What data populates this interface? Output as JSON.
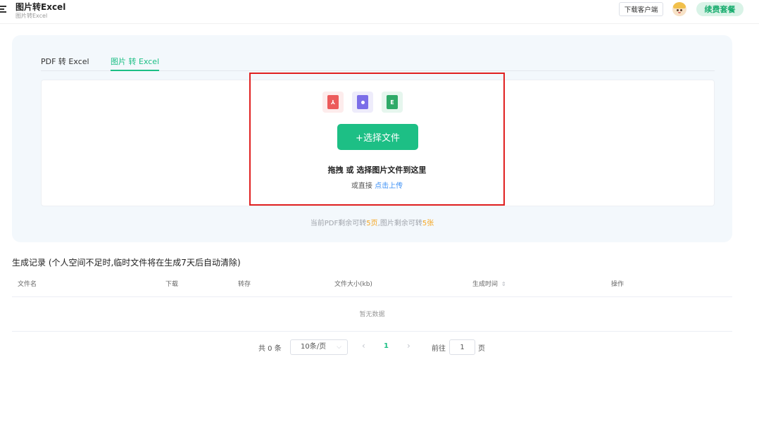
{
  "header": {
    "title": "图片转Excel",
    "subtitle": "图片转Excel",
    "download_client": "下载客户端",
    "renew": "续费套餐"
  },
  "tabs": [
    {
      "label": "PDF 转 Excel"
    },
    {
      "label": "图片 转 Excel"
    }
  ],
  "upload": {
    "file_icons": [
      "pdf-icon",
      "image-file-icon",
      "excel-icon"
    ],
    "pdf_icon_glyph": "⅄",
    "excel_icon_glyph": "E",
    "select_button": "+选择文件",
    "drag_hint": "拖拽 或 选择图片文件到这里",
    "direct_prefix": "或直接",
    "direct_link": "点击上传"
  },
  "quota": {
    "prefix": "当前PDF剩余可转",
    "pdf_num": "5",
    "pdf_unit": "页",
    "mid": ",图片剩余可转",
    "image_num": "5",
    "image_unit": "张"
  },
  "records": {
    "title": "生成记录 (个人空间不足时,临时文件将在生成7天后自动清除)",
    "columns": [
      "文件名",
      "下载",
      "转存",
      "文件大小(kb)",
      "生成时间",
      "操作"
    ],
    "sort_glyph": "⇕",
    "empty": "暂无数据"
  },
  "pagination": {
    "total": "共 0 条",
    "page_size": "10条/页",
    "size_chevron": "⌵",
    "prev": "‹",
    "current": "1",
    "next": "›",
    "goto": "前往",
    "goto_value": "1",
    "page_unit": "页"
  },
  "colors": {
    "accent": "#1dbf85",
    "highlight_box": "#e02020",
    "quota_number": "#f5a623",
    "link": "#3b8ff5"
  }
}
